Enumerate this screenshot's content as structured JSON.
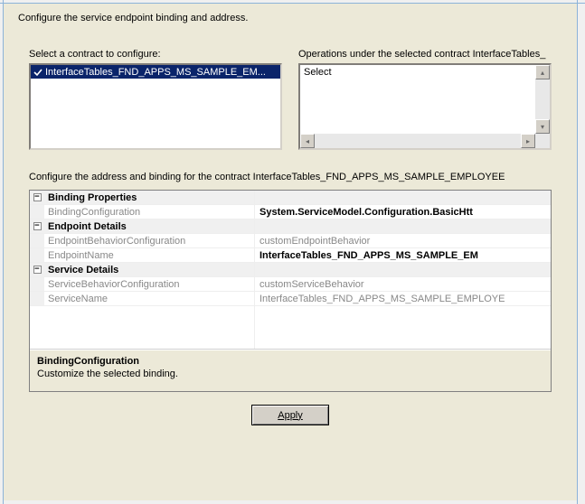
{
  "page_title": "Configure the service endpoint binding and address.",
  "contract_section": {
    "label": "Select a contract to configure:",
    "items": [
      {
        "text": "InterfaceTables_FND_APPS_MS_SAMPLE_EM...",
        "selected": true,
        "checked": true
      }
    ]
  },
  "operations_section": {
    "label": "Operations under the selected contract  InterfaceTables_",
    "items": [
      "Select"
    ]
  },
  "binding_section": {
    "label": "Configure the address and binding for the contract  InterfaceTables_FND_APPS_MS_SAMPLE_EMPLOYEE",
    "categories": [
      {
        "name": "Binding Properties",
        "rows": [
          {
            "key": "BindingConfiguration",
            "value": "System.ServiceModel.Configuration.BasicHtt",
            "bold": true
          }
        ]
      },
      {
        "name": "Endpoint Details",
        "rows": [
          {
            "key": "EndpointBehaviorConfiguration",
            "value": "customEndpointBehavior",
            "bold": false
          },
          {
            "key": "EndpointName",
            "value": "InterfaceTables_FND_APPS_MS_SAMPLE_EM",
            "bold": true
          }
        ]
      },
      {
        "name": "Service Details",
        "rows": [
          {
            "key": "ServiceBehaviorConfiguration",
            "value": "customServiceBehavior",
            "bold": false
          },
          {
            "key": "ServiceName",
            "value": "InterfaceTables_FND_APPS_MS_SAMPLE_EMPLOYE",
            "bold": false
          }
        ]
      }
    ],
    "help": {
      "title": "BindingConfiguration",
      "desc": "Customize the selected binding."
    }
  },
  "buttons": {
    "apply": "Apply"
  },
  "glyphs": {
    "minus": "−",
    "up": "▴",
    "down": "▾",
    "left": "◂",
    "right": "▸"
  }
}
